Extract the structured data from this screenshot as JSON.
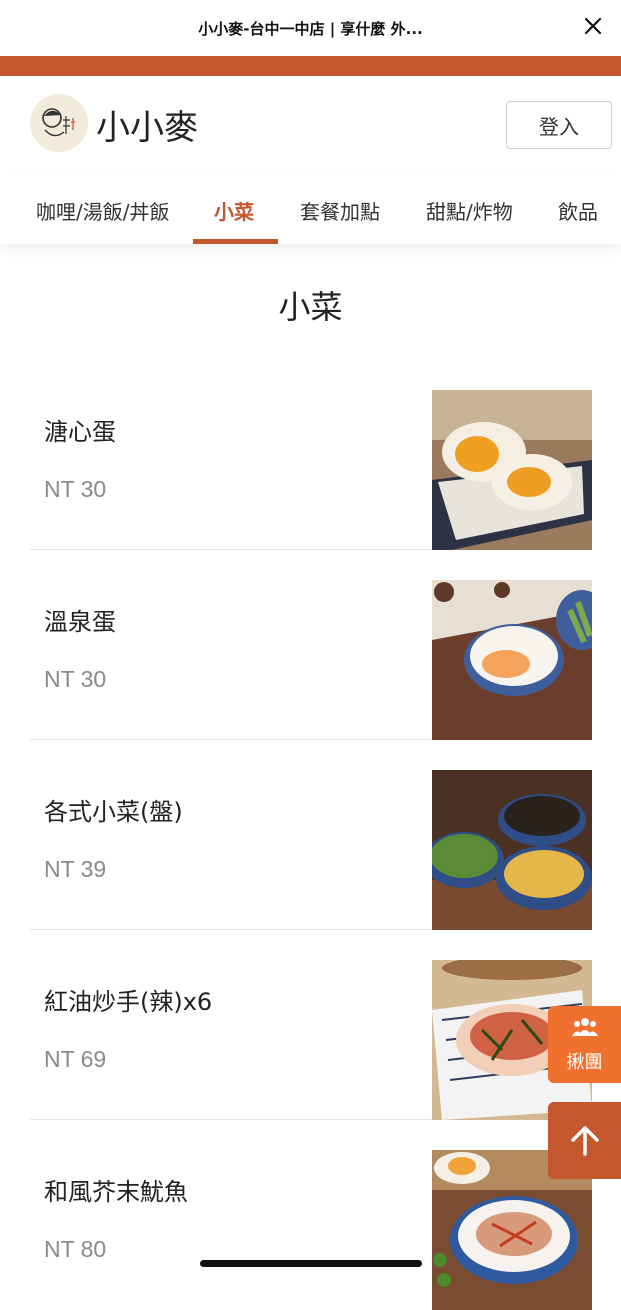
{
  "browser": {
    "title": "小小麥-台中一中店 | 享什麼 外...",
    "close_icon": "close-icon"
  },
  "brand": {
    "name": "小小麥",
    "color": "#c4572e",
    "accent": "#f0712d"
  },
  "header": {
    "login_label": "登入"
  },
  "categories": [
    {
      "label": "咖哩/湯飯/丼飯",
      "active": false
    },
    {
      "label": "小菜",
      "active": true
    },
    {
      "label": "套餐加點",
      "active": false
    },
    {
      "label": "甜點/炸物",
      "active": false
    },
    {
      "label": "飲品",
      "active": false
    }
  ],
  "section": {
    "title": "小菜"
  },
  "items": [
    {
      "name": "溏心蛋",
      "price": "NT 30"
    },
    {
      "name": "溫泉蛋",
      "price": "NT 30"
    },
    {
      "name": "各式小菜(盤)",
      "price": "NT 39"
    },
    {
      "name": "紅油炒手(辣)x6",
      "price": "NT 69"
    },
    {
      "name": "和風芥末魷魚",
      "price": "NT 80"
    }
  ],
  "floating": {
    "group_label": "揪團",
    "group_icon": "people-icon",
    "top_icon": "arrow-up-icon"
  }
}
